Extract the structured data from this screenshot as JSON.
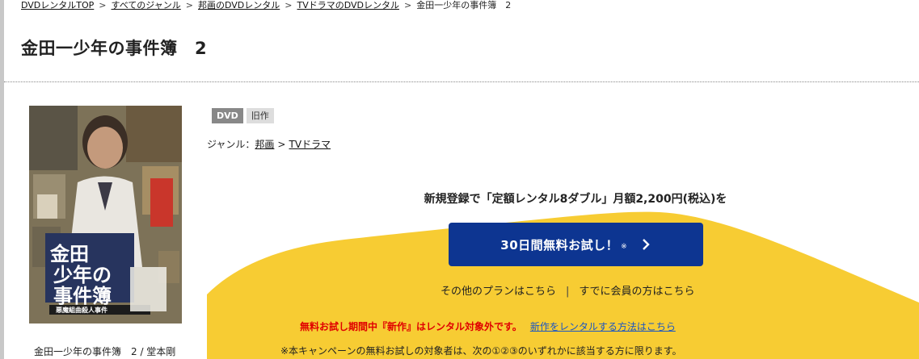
{
  "breadcrumb": {
    "items": [
      "DVDレンタルTOP",
      "すべてのジャンル",
      "邦画のDVDレンタル",
      "TVドラマのDVDレンタル"
    ],
    "current": "金田一少年の事件簿　2",
    "separator": ">"
  },
  "page_title": "金田一少年の事件簿　2",
  "jacket": {
    "title_text": "金田一少年の事件簿",
    "subtitle_text": "悪魔組曲殺人事件"
  },
  "product_caption": "金田一少年の事件簿　2 / 堂本剛",
  "tags": {
    "format": "DVD",
    "status": "旧作"
  },
  "genre": {
    "label": "ジャンル：",
    "items": [
      "邦画",
      "TVドラマ"
    ],
    "separator": ">"
  },
  "promo": {
    "heading": "新規登録で「定額レンタル8ダブル」月額2,200円(税込)を",
    "trial_button": "30日間無料お試し！",
    "trial_mark": "※",
    "other_plans": "その他のプランはこちら",
    "plan_separator": "|",
    "member_link": "すでに会員の方はこちら",
    "warning": "無料お試し期間中『新作』はレンタル対象外です。",
    "new_rental_link": "新作をレンタルする方法はこちら",
    "note": "※本キャンペーンの無料お試しの対象者は、次の①②③のいずれかに該当する方に限ります。"
  },
  "colors": {
    "accent_button": "#0d3591",
    "promo_yellow": "#f7cc33",
    "warning_red": "#e00000",
    "link_blue": "#1a55c4"
  }
}
